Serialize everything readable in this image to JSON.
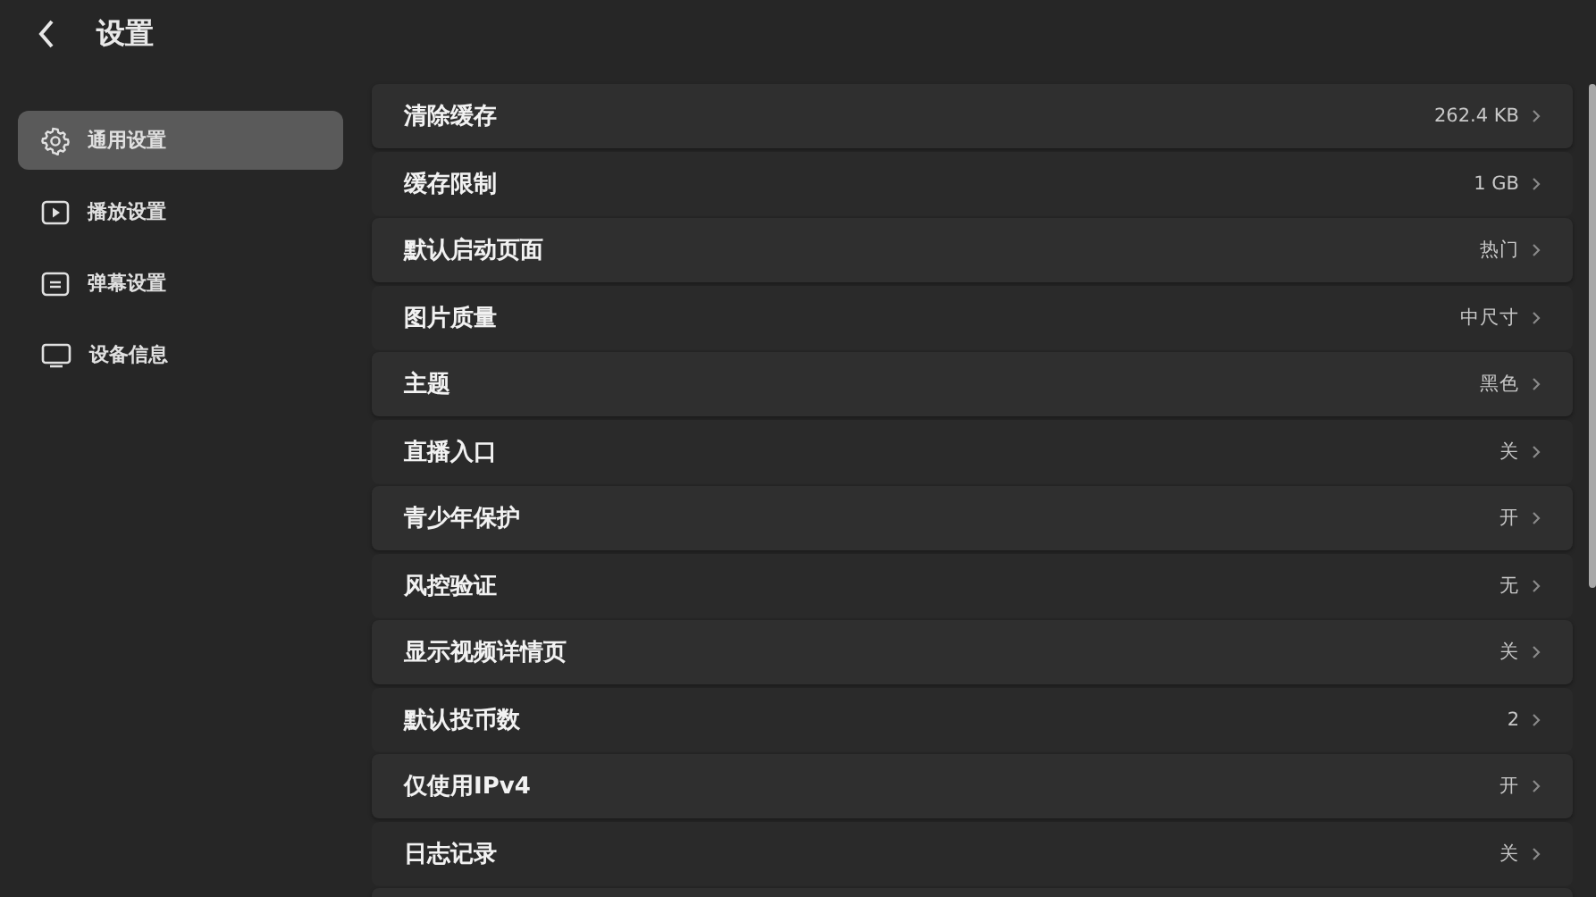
{
  "header": {
    "title": "设置"
  },
  "sidebar": {
    "items": [
      {
        "label": "通用设置",
        "selected": true
      },
      {
        "label": "播放设置",
        "selected": false
      },
      {
        "label": "弹幕设置",
        "selected": false
      },
      {
        "label": "设备信息",
        "selected": false
      }
    ]
  },
  "settings": [
    {
      "label": "清除缓存",
      "value": "262.4 KB"
    },
    {
      "label": "缓存限制",
      "value": "1 GB"
    },
    {
      "label": "默认启动页面",
      "value": "热门"
    },
    {
      "label": "图片质量",
      "value": "中尺寸"
    },
    {
      "label": "主题",
      "value": "黑色"
    },
    {
      "label": "直播入口",
      "value": "关"
    },
    {
      "label": "青少年保护",
      "value": "开"
    },
    {
      "label": "风控验证",
      "value": "无"
    },
    {
      "label": "显示视频详情页",
      "value": "关"
    },
    {
      "label": "默认投币数",
      "value": "2"
    },
    {
      "label": "仅使用IPv4",
      "value": "开"
    },
    {
      "label": "日志记录",
      "value": "关"
    }
  ]
}
